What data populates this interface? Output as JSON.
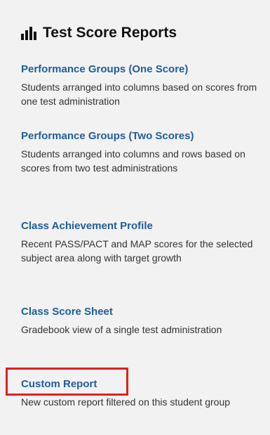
{
  "panel": {
    "title": "Test Score Reports",
    "icon": "bar-chart-icon",
    "reports": [
      {
        "link": "Performance Groups (One Score)",
        "description": "Students arranged into columns based on scores from one test administration"
      },
      {
        "link": "Performance Groups (Two Scores)",
        "description": "Students arranged into columns and rows based on scores from two test administrations"
      },
      {
        "link": "Class Achievement Profile",
        "description": "Recent PASS/PACT and MAP scores for the selected subject area along with target growth"
      },
      {
        "link": "Class Score Sheet",
        "description": "Gradebook view of a single test administration"
      },
      {
        "link": "Custom Report",
        "description": "New custom report filtered on this student group"
      }
    ]
  },
  "colors": {
    "link": "#1f5e9c",
    "text": "#333333",
    "background": "#f2f2f2",
    "highlight": "#e0201e"
  }
}
